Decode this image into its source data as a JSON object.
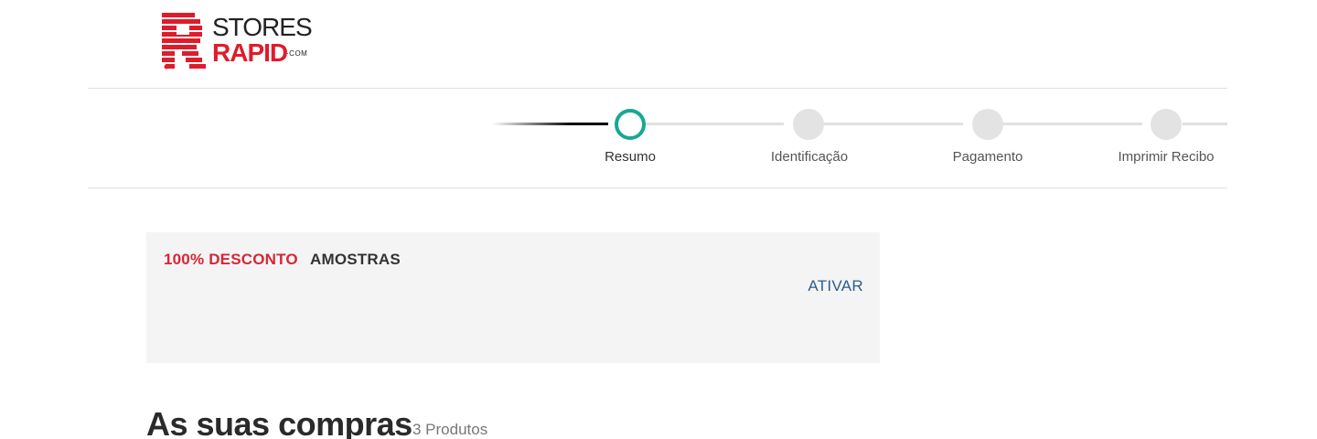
{
  "header": {
    "logo": {
      "top_text": "STORES",
      "bottom_text": "RAPID",
      "suffix": "·COM",
      "colors": {
        "brand_red": "#e01b2a",
        "dark": "#222222"
      }
    }
  },
  "stepper": {
    "steps": [
      {
        "label": "Resumo",
        "state": "active"
      },
      {
        "label": "Identificação",
        "state": "pending"
      },
      {
        "label": "Pagamento",
        "state": "pending"
      },
      {
        "label": "Imprimir Recibo",
        "state": "pending"
      }
    ],
    "colors": {
      "active": "#17a894",
      "pending": "#e3e3e3"
    }
  },
  "promo": {
    "discount_text": "100% DESCONTO",
    "label": "AMOSTRAS",
    "action_label": "ATIVAR",
    "colors": {
      "discount": "#d62635",
      "action": "#2a5f8f",
      "background": "#f4f4f4"
    }
  },
  "purchases": {
    "title": "As suas compras",
    "count_text": "3 Produtos"
  }
}
